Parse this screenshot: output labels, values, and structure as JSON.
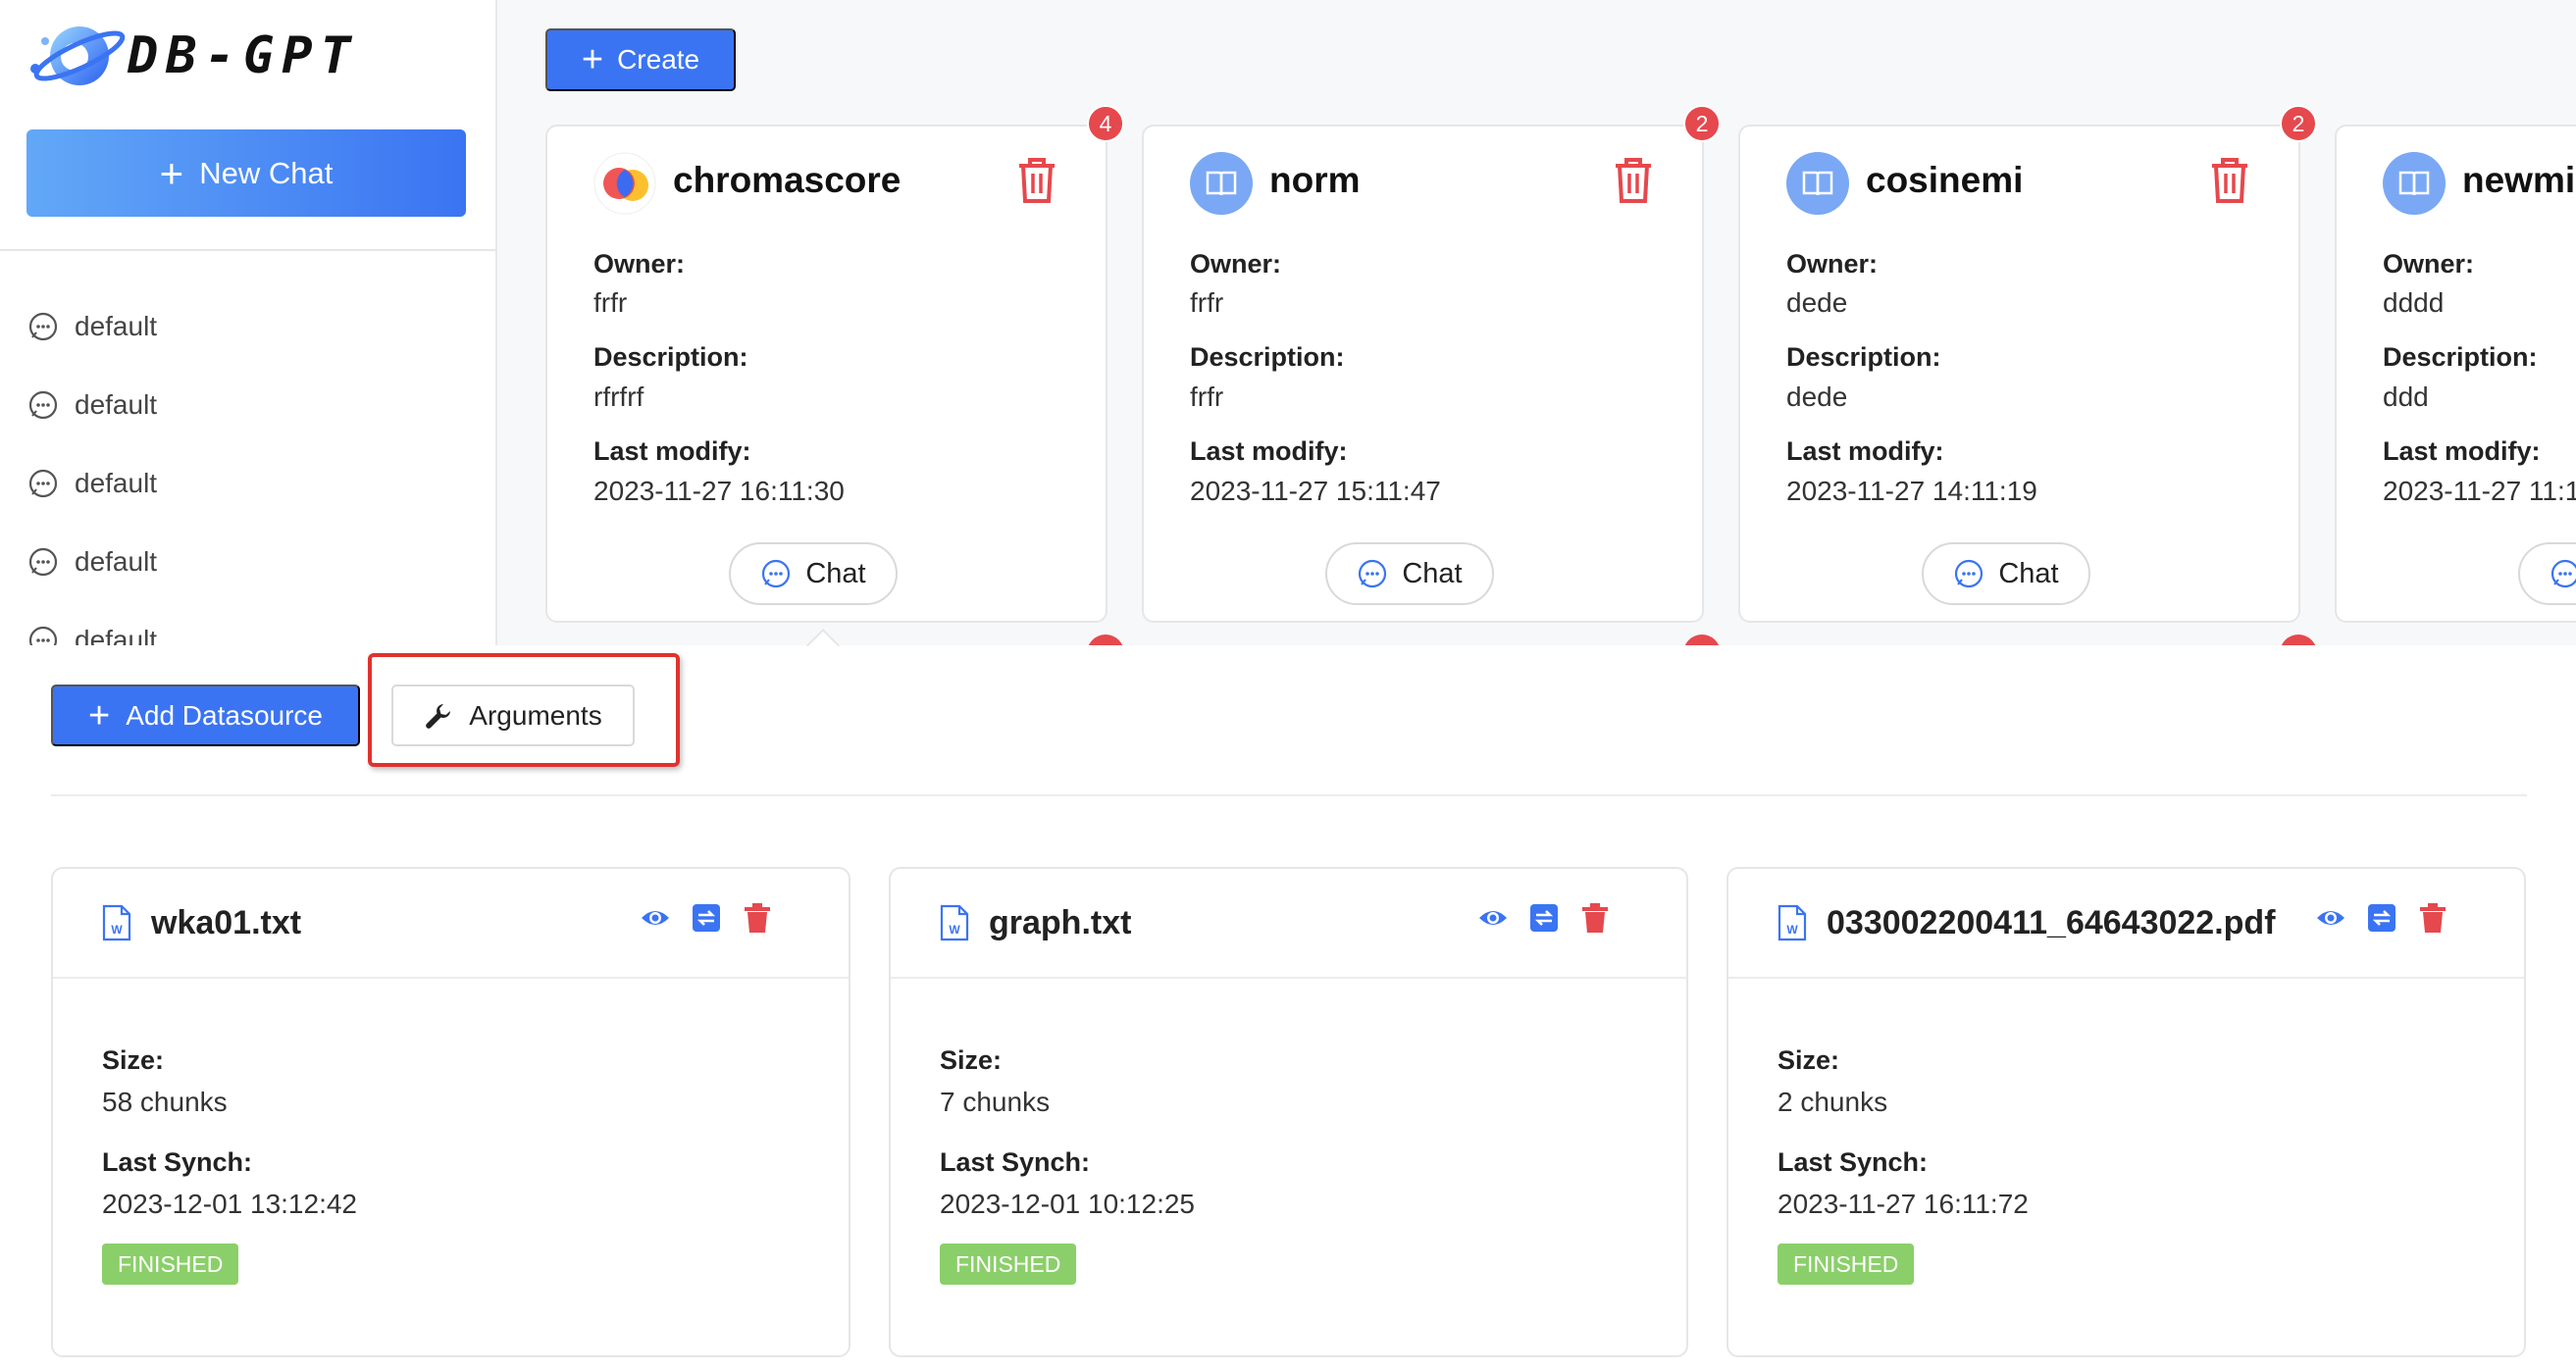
{
  "app": {
    "logo_text": "DB-GPT"
  },
  "sidebar": {
    "new_chat_label": "New Chat",
    "conversations": [
      {
        "label": "default"
      },
      {
        "label": "default"
      },
      {
        "label": "default"
      },
      {
        "label": "default"
      },
      {
        "label": "default"
      }
    ]
  },
  "main": {
    "create_label": "Create",
    "labels": {
      "owner": "Owner:",
      "description": "Description:",
      "last_modify": "Last modify:",
      "chat": "Chat"
    },
    "spaces": [
      {
        "name": "chromascore",
        "owner": "frfr",
        "description": "rfrfrf",
        "last_modify": "2023-11-27 16:11:30",
        "badge": "4"
      },
      {
        "name": "norm",
        "owner": "frfr",
        "description": "frfr",
        "last_modify": "2023-11-27 15:11:47",
        "badge": "2"
      },
      {
        "name": "cosinemi",
        "owner": "dede",
        "description": "dede",
        "last_modify": "2023-11-27 14:11:19",
        "badge": "2"
      },
      {
        "name": "newmi",
        "owner": "dddd",
        "description": "ddd",
        "last_modify": "2023-11-27 11:1"
      }
    ]
  },
  "documents": {
    "add_datasource_label": "Add Datasource",
    "arguments_label": "Arguments",
    "labels": {
      "size": "Size:",
      "last_synch": "Last Synch:"
    },
    "items": [
      {
        "name": "wka01.txt",
        "size": "58 chunks",
        "last_synch": "2023-12-01 13:12:42",
        "status": "FINISHED"
      },
      {
        "name": "graph.txt",
        "size": "7 chunks",
        "last_synch": "2023-12-01 10:12:25",
        "status": "FINISHED"
      },
      {
        "name": "033002200411_64643022.pdf",
        "size": "2 chunks",
        "last_synch": "2023-11-27 16:11:72",
        "status": "FINISHED"
      }
    ]
  },
  "colors": {
    "primary": "#3b74f2",
    "danger": "#e5484d",
    "success": "#8bcf6a",
    "highlight": "#e0322d"
  },
  "icons": {
    "conversation": "chat-bubble-icon",
    "delete": "trash-icon",
    "view": "eye-icon",
    "sync": "sync-icon",
    "file": "word-file-icon",
    "arguments": "wrench-icon",
    "space": "book-icon"
  }
}
